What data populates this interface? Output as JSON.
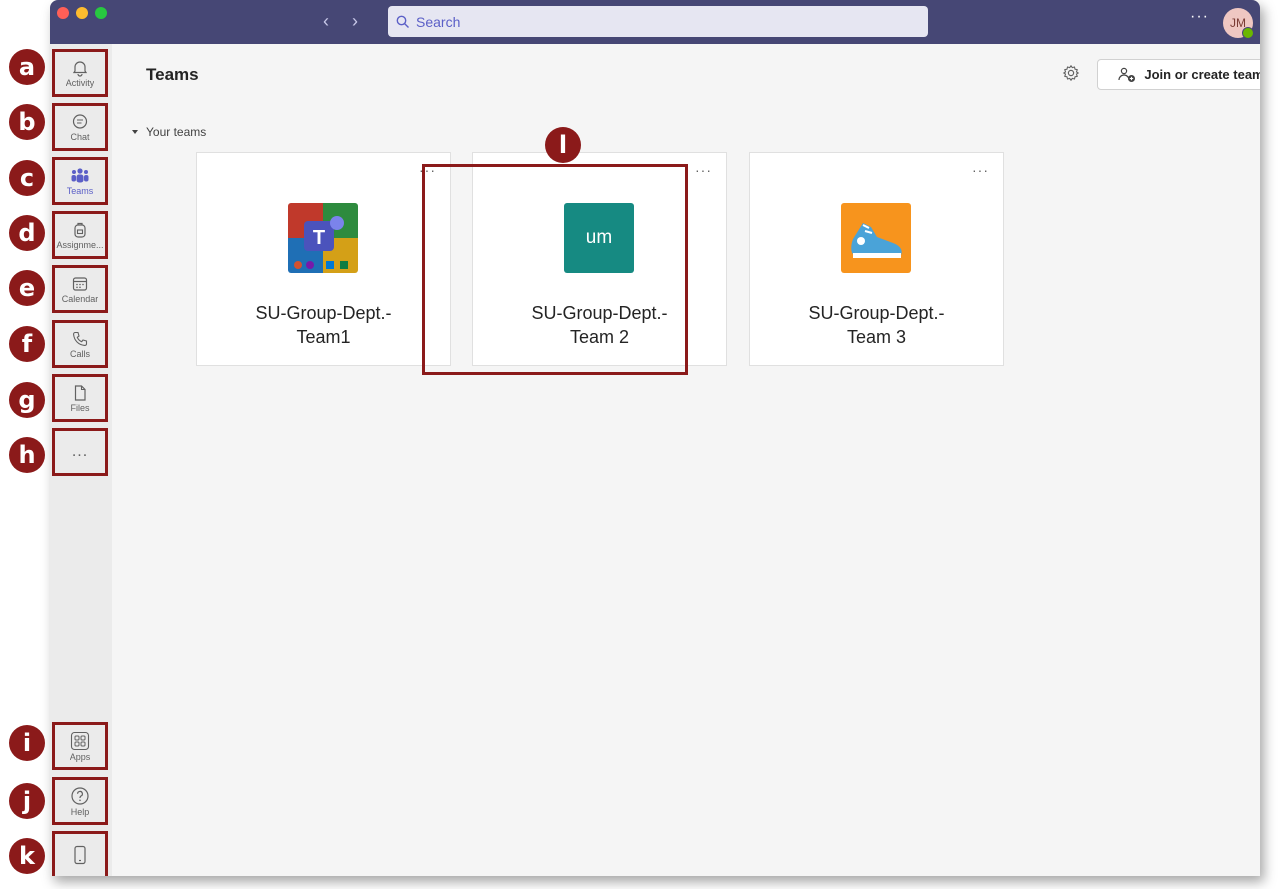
{
  "titlebar": {
    "search_placeholder": "Search",
    "more_label": "···",
    "avatar_initials": "JM",
    "presence_color": "#6bb700",
    "bar_color": "#464775"
  },
  "rail": {
    "items": [
      {
        "id": "activity",
        "label": "Activity",
        "icon": "bell-icon"
      },
      {
        "id": "chat",
        "label": "Chat",
        "icon": "chat-icon"
      },
      {
        "id": "teams",
        "label": "Teams",
        "icon": "teams-icon",
        "active": true
      },
      {
        "id": "assignments",
        "label": "Assignme...",
        "icon": "backpack-icon"
      },
      {
        "id": "calendar",
        "label": "Calendar",
        "icon": "calendar-icon"
      },
      {
        "id": "calls",
        "label": "Calls",
        "icon": "phone-icon"
      },
      {
        "id": "files",
        "label": "Files",
        "icon": "file-icon"
      },
      {
        "id": "more",
        "label": "...",
        "icon": "more-icon"
      },
      {
        "id": "apps",
        "label": "Apps",
        "icon": "apps-icon"
      },
      {
        "id": "help",
        "label": "Help",
        "icon": "help-icon"
      },
      {
        "id": "device",
        "label": "",
        "icon": "phone-device-icon"
      }
    ],
    "accent_color": "#5b5fc7"
  },
  "main": {
    "title": "Teams",
    "join_button": "Join or create team",
    "section_label": "Your teams",
    "teams": [
      {
        "name_line1": "SU-Group-Dept.-",
        "name_line2": "Team1",
        "tile": "teams-logo-icon"
      },
      {
        "name_line1": "SU-Group-Dept.-",
        "name_line2": "Team 2",
        "tile_text": "um",
        "tile_color": "#168a82"
      },
      {
        "name_line1": "SU-Group-Dept.-",
        "name_line2": "Team 3",
        "tile": "sneaker-icon",
        "tile_color": "#f7941d"
      }
    ],
    "card_more": "···"
  },
  "annotations": {
    "markers": [
      "a",
      "b",
      "c",
      "d",
      "e",
      "f",
      "g",
      "h",
      "i",
      "j",
      "k",
      "l"
    ],
    "color": "#8b1a1a"
  }
}
